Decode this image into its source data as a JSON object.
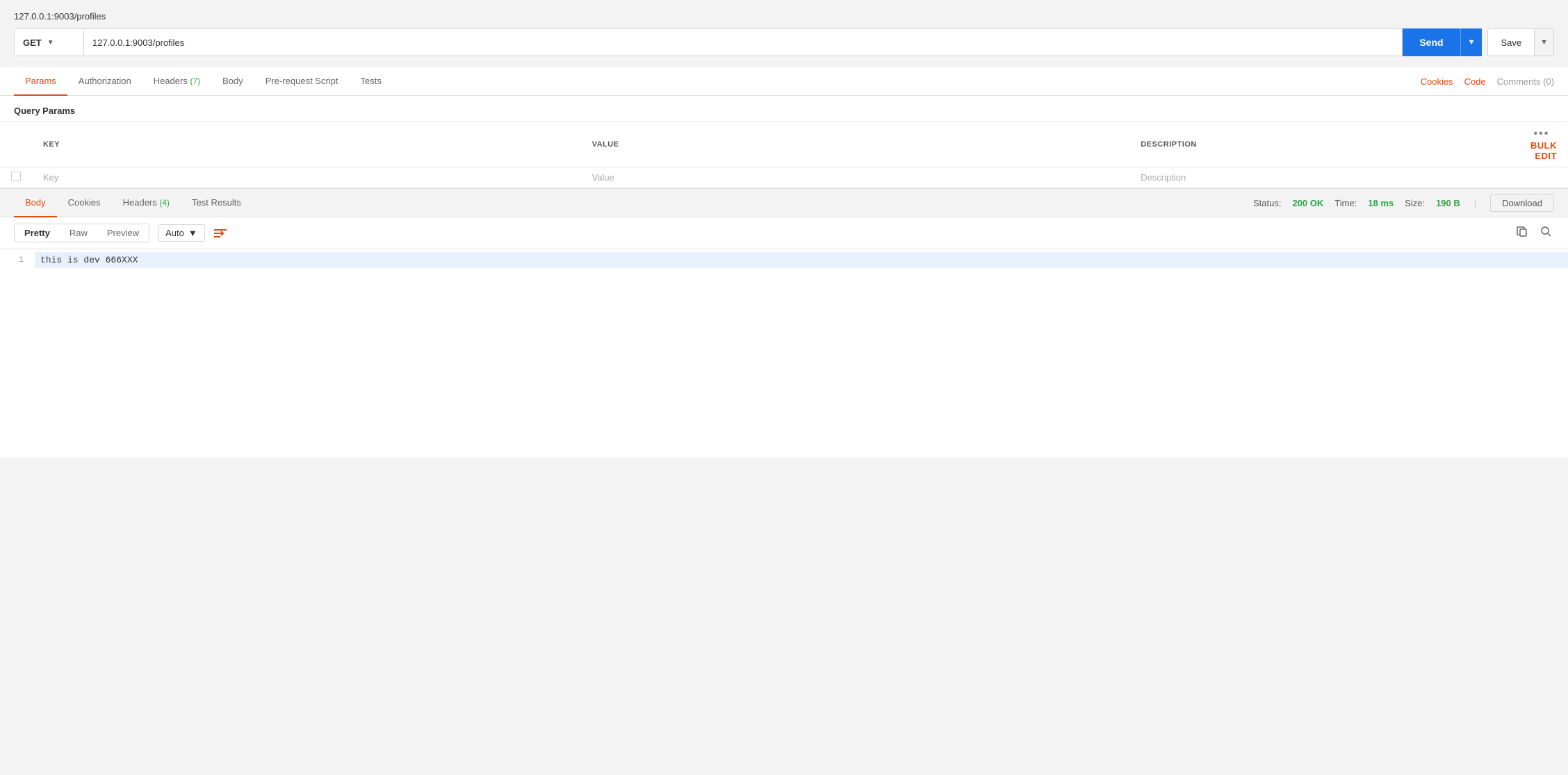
{
  "page": {
    "title": "127.0.0.1:9003/profiles"
  },
  "request": {
    "method": "GET",
    "url": "127.0.0.1:9003/profiles",
    "send_label": "Send",
    "save_label": "Save"
  },
  "request_tabs": [
    {
      "id": "params",
      "label": "Params",
      "active": true
    },
    {
      "id": "authorization",
      "label": "Authorization",
      "active": false
    },
    {
      "id": "headers",
      "label": "Headers",
      "badge": "(7)",
      "active": false
    },
    {
      "id": "body",
      "label": "Body",
      "active": false
    },
    {
      "id": "pre-request",
      "label": "Pre-request Script",
      "active": false
    },
    {
      "id": "tests",
      "label": "Tests",
      "active": false
    }
  ],
  "request_tab_right": [
    {
      "id": "cookies",
      "label": "Cookies",
      "muted": false
    },
    {
      "id": "code",
      "label": "Code",
      "muted": false
    },
    {
      "id": "comments",
      "label": "Comments (0)",
      "muted": true
    }
  ],
  "query_params": {
    "section_title": "Query Params",
    "columns": {
      "key": "KEY",
      "value": "VALUE",
      "description": "DESCRIPTION"
    },
    "bulk_edit_label": "Bulk Edit",
    "placeholder_row": {
      "key": "Key",
      "value": "Value",
      "description": "Description"
    }
  },
  "response": {
    "status_label": "Status:",
    "status_value": "200 OK",
    "time_label": "Time:",
    "time_value": "18 ms",
    "size_label": "Size:",
    "size_value": "190 B",
    "download_label": "Download"
  },
  "response_tabs": [
    {
      "id": "body",
      "label": "Body",
      "active": true
    },
    {
      "id": "cookies",
      "label": "Cookies",
      "active": false
    },
    {
      "id": "headers",
      "label": "Headers",
      "badge": "(4)",
      "active": false
    },
    {
      "id": "test-results",
      "label": "Test Results",
      "active": false
    }
  ],
  "response_toolbar": {
    "format_buttons": [
      {
        "id": "pretty",
        "label": "Pretty",
        "active": true
      },
      {
        "id": "raw",
        "label": "Raw",
        "active": false
      },
      {
        "id": "preview",
        "label": "Preview",
        "active": false
      }
    ],
    "auto_label": "Auto",
    "wrap_icon": "≡→"
  },
  "response_body": {
    "lines": [
      {
        "number": "1",
        "content": "this is dev 666XXX"
      }
    ]
  }
}
